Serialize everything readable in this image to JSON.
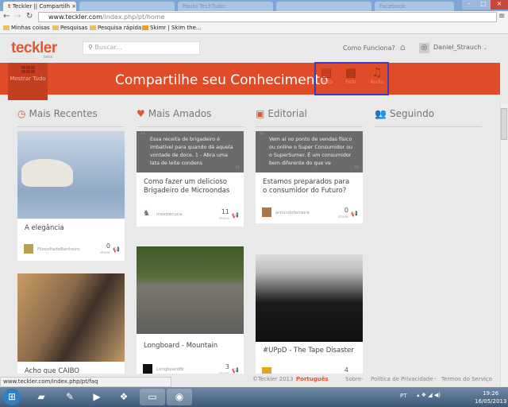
{
  "browser": {
    "tabs": [
      {
        "label": "Teckler || Compartilh",
        "active": true
      },
      {
        "label": ""
      },
      {
        "label": "Paulo TechTudo"
      },
      {
        "label": ""
      },
      {
        "label": "Facebook"
      },
      {
        "label": ""
      }
    ],
    "url_host": "www.teckler.com",
    "url_path": "/index.php/pt/home",
    "bookmarks": [
      "Minhas coisas",
      "Pesquisas",
      "Pesquisa rápida",
      "Skimr | Skim the..."
    ]
  },
  "header": {
    "logo": "teckler",
    "beta": "beta",
    "search_placeholder": "Buscar...",
    "how": "Como Funciona?",
    "user": "Daniel_Strauch"
  },
  "banner": {
    "show_all": "Mostrar Tudo",
    "title": "Compartilhe seu Conhecimento",
    "post_types": [
      {
        "label": "Texto",
        "icon": "document-icon"
      },
      {
        "label": "Foto",
        "icon": "photo-icon"
      },
      {
        "label": "Áudio",
        "icon": "music-icon"
      }
    ]
  },
  "columns": [
    {
      "title": "Mais Recentes",
      "icon": "clock-icon",
      "cards": [
        {
          "type": "image",
          "title": "A elegância",
          "author": "FilosofiadeBanheiro",
          "shares": "0",
          "image": "polar bear"
        },
        {
          "type": "image",
          "title": "Acho que CAIBO",
          "image": "cat in box"
        }
      ]
    },
    {
      "title": "Mais Amados",
      "icon": "heart-icon",
      "cards": [
        {
          "type": "quote",
          "quote": "Essa receita de brigadeiro é imbatível para quando dá aquela vontade de doce. 1 - Abra uma lata de leite condens",
          "title": "Como fazer um delicioso Brigadeiro de Microondas",
          "author": "mestrecuca",
          "shares": "11"
        },
        {
          "type": "image",
          "title": "Longboard - Mountain",
          "author": "LongboardBr",
          "shares": "3",
          "image": "longboarders"
        }
      ]
    },
    {
      "title": "Editorial",
      "icon": "editorial-icon",
      "cards": [
        {
          "type": "quote",
          "quote": "Vem aí no ponto de vendas físico ou online o Super Consumidor ou o SuperSumer. É um consumidor bem diferente do que ve",
          "title": "Estamos preparados para o consumidor do Futuro?",
          "author": "armindoferreira",
          "shares": "0"
        },
        {
          "type": "image",
          "title": "#UPpD - The Tape Disaster",
          "shares": "4",
          "image": "band"
        }
      ]
    },
    {
      "title": "Seguindo",
      "icon": "users-icon",
      "cards": []
    }
  ],
  "shares_label": "shares",
  "footer": {
    "copyright": "©Teckler 2013",
    "language": "Português",
    "links": [
      "Sobre",
      "Política de Privacidade",
      "Termos do Serviço"
    ]
  },
  "status_url": "www.teckler.com/index.php/pt/faq",
  "taskbar": {
    "lang": "PT",
    "time": "19:26",
    "date": "16/05/2013"
  }
}
